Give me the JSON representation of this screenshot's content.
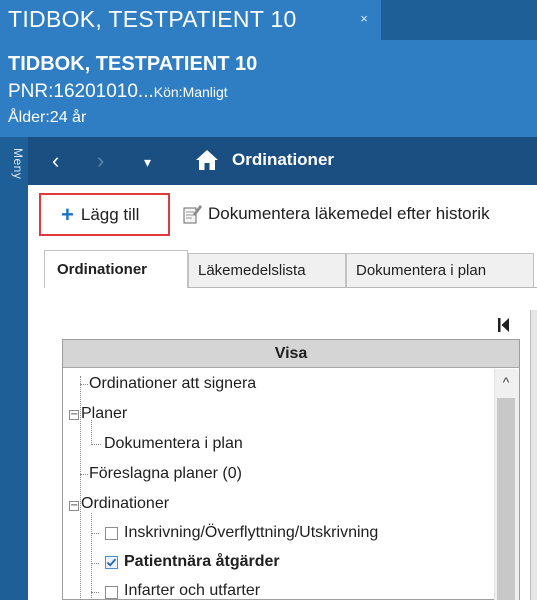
{
  "window": {
    "tab_title": "TIDBOK, TESTPATIENT 10",
    "tab_close_glyph": "×"
  },
  "patient": {
    "name": "TIDBOK, TESTPATIENT 10",
    "pnr": "PNR:16201010...",
    "gender": "Kön:Manligt",
    "age": "Ålder:24 år"
  },
  "menu": {
    "label": "Meny"
  },
  "nav": {
    "back_glyph": "‹",
    "forward_glyph": "›",
    "dropdown_glyph": "▾",
    "title": "Ordinationer"
  },
  "toolbar": {
    "add_label": "Lägg till",
    "doc_label": "Dokumentera läkemedel efter historik"
  },
  "tabs": [
    {
      "label": "Ordinationer",
      "active": true
    },
    {
      "label": "Läkemedelslista",
      "active": false
    },
    {
      "label": "Dokumentera i plan",
      "active": false
    }
  ],
  "tree": {
    "header": "Visa",
    "items": [
      {
        "label": "Ordinationer att signera"
      },
      {
        "label": "Planer",
        "expander": "−"
      },
      {
        "label": "Dokumentera i plan"
      },
      {
        "label": "Föreslagna planer (0)"
      },
      {
        "label": "Ordinationer",
        "expander": "−"
      },
      {
        "label": "Inskrivning/Överflyttning/Utskrivning",
        "checked": false
      },
      {
        "label": "Patientnära åtgärder",
        "checked": true
      },
      {
        "label": "Infarter och utfarter",
        "checked": false
      }
    ]
  },
  "scrollbar": {
    "up_glyph": "^"
  },
  "colors": {
    "header_blue": "#2f7ec3",
    "nav_blue": "#1b4f82",
    "highlight_red": "#e0393e",
    "add_icon_blue": "#1e73c8"
  }
}
